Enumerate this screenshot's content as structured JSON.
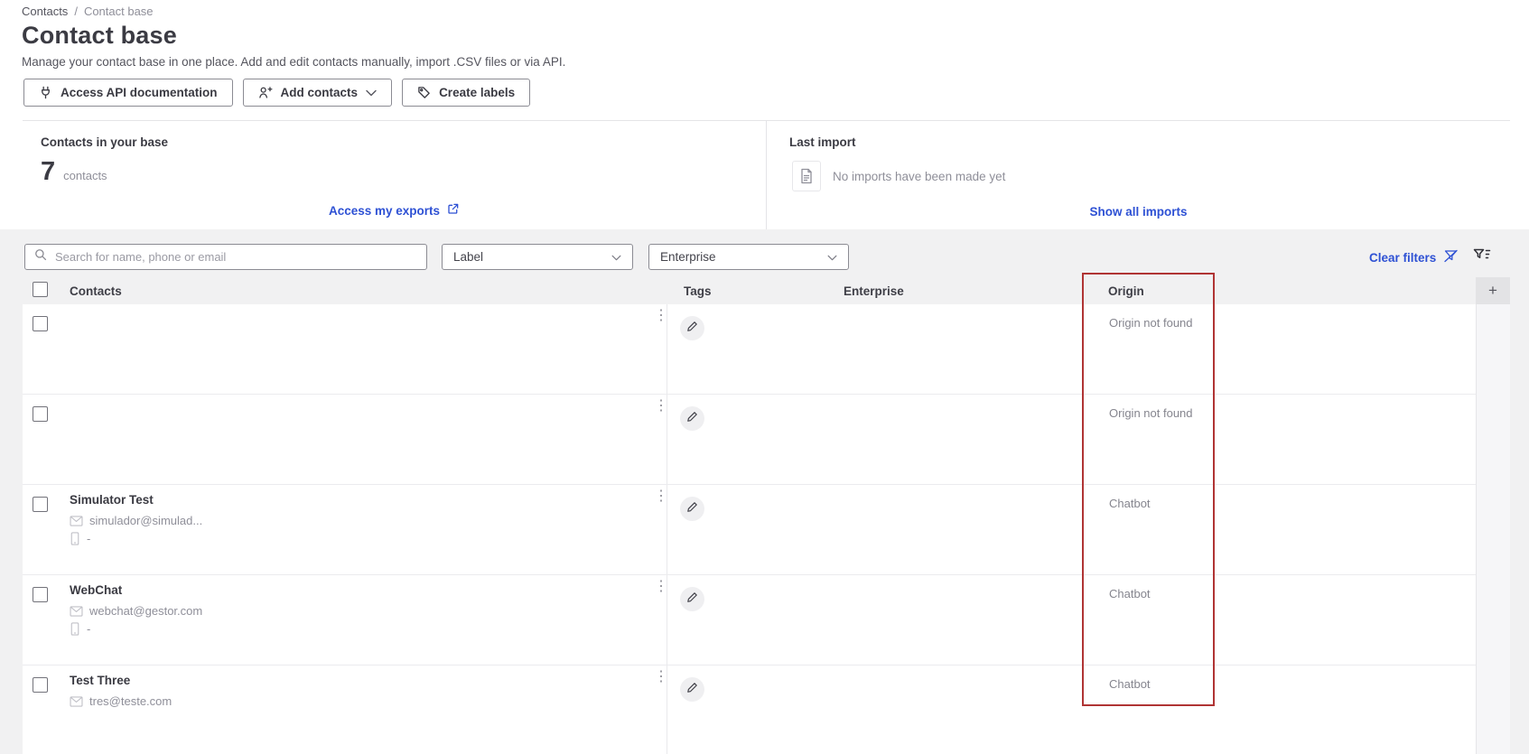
{
  "breadcrumb": {
    "items": [
      "Contacts",
      "Contact base"
    ],
    "separator": "/"
  },
  "header": {
    "title": "Contact base",
    "description": "Manage your contact base in one place. Add and edit contacts manually, import .CSV files or via API.",
    "buttons": {
      "api": "Access API documentation",
      "add_contacts": "Add contacts",
      "create_labels": "Create labels"
    }
  },
  "cards": {
    "contacts_card": {
      "title": "Contacts in your base",
      "count": "7",
      "count_label": "contacts",
      "link": "Access my exports"
    },
    "import_card": {
      "title": "Last import",
      "empty_message": "No imports have been made yet",
      "link": "Show all imports"
    }
  },
  "filters": {
    "search_placeholder": "Search for name, phone or email",
    "label_filter": "Label",
    "enterprise_filter": "Enterprise",
    "clear_filters": "Clear filters"
  },
  "table": {
    "columns": {
      "contacts": "Contacts",
      "tags": "Tags",
      "enterprise": "Enterprise",
      "origin": "Origin"
    },
    "rows": [
      {
        "name": "",
        "email": "",
        "phone": "",
        "origin": "Origin not found"
      },
      {
        "name": "",
        "email": "",
        "phone": "",
        "origin": "Origin not found"
      },
      {
        "name": "Simulator Test",
        "email": "simulador@simulad...",
        "phone": "-",
        "origin": "Chatbot"
      },
      {
        "name": "WebChat",
        "email": "webchat@gestor.com",
        "phone": "-",
        "origin": "Chatbot"
      },
      {
        "name": "Test Three",
        "email": "tres@teste.com",
        "phone": "",
        "origin": "Chatbot"
      }
    ]
  },
  "icons": {
    "kebab_glyph": "⋮",
    "plus_glyph": "+"
  },
  "colors": {
    "accent_blue": "#2e51d4",
    "highlight_red": "#b03434",
    "section_bg": "#f1f1f2",
    "row_bg": "#ffffff"
  }
}
